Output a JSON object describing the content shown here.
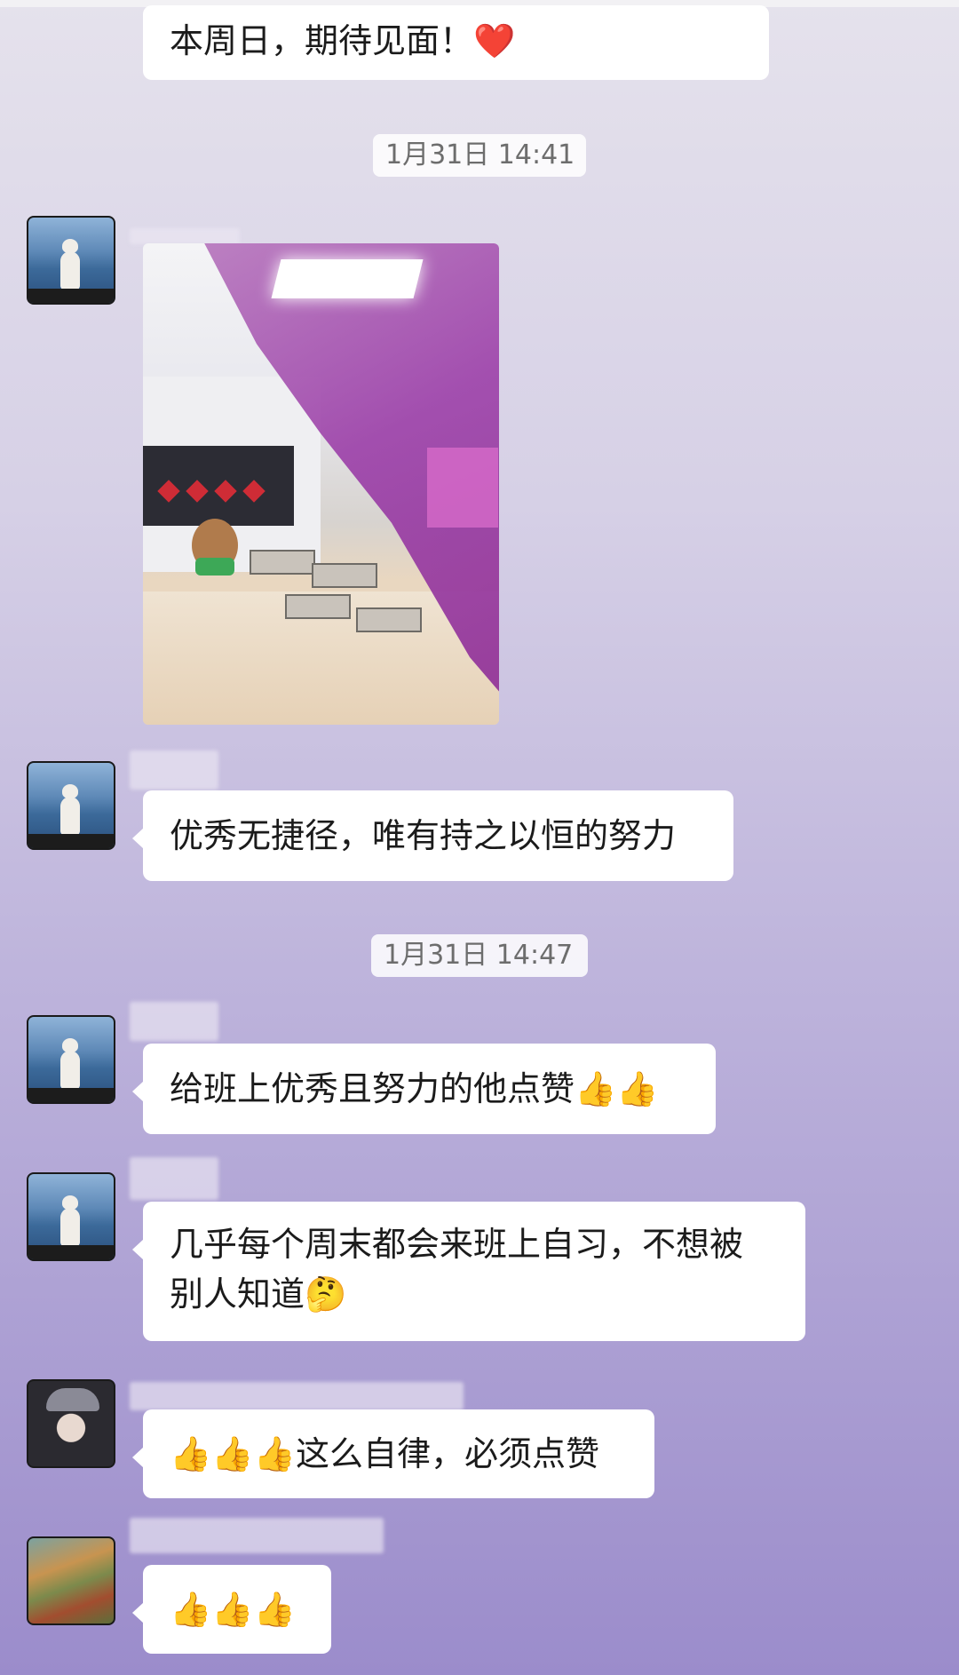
{
  "messages": {
    "m0": {
      "text": "本周日，期待见面！❤️"
    },
    "t1": {
      "time": "1月31日 14:41"
    },
    "m2": {
      "text": "优秀无捷径，唯有持之以恒的努力"
    },
    "t2": {
      "time": "1月31日 14:47"
    },
    "m3": {
      "text": "给班上优秀且努力的他点赞👍👍"
    },
    "m4": {
      "line1": "几乎每个周末都会来班上自习，不想被",
      "line2": "别人知道🤔"
    },
    "m5": {
      "text": "👍👍👍这么自律，必须点赞"
    },
    "m6": {
      "text": "👍👍👍"
    }
  },
  "colors": {
    "bubble": "#ffffff",
    "background_top": "#e5e2ec",
    "background_bottom": "#9b8ccb",
    "time_text": "#6d6d6d"
  },
  "icons": {
    "avatar_1": "avatar-cat-by-sea",
    "avatar_2": "avatar-girl-portrait",
    "avatar_3": "avatar-garden-pond",
    "photo": "classroom-photo"
  }
}
